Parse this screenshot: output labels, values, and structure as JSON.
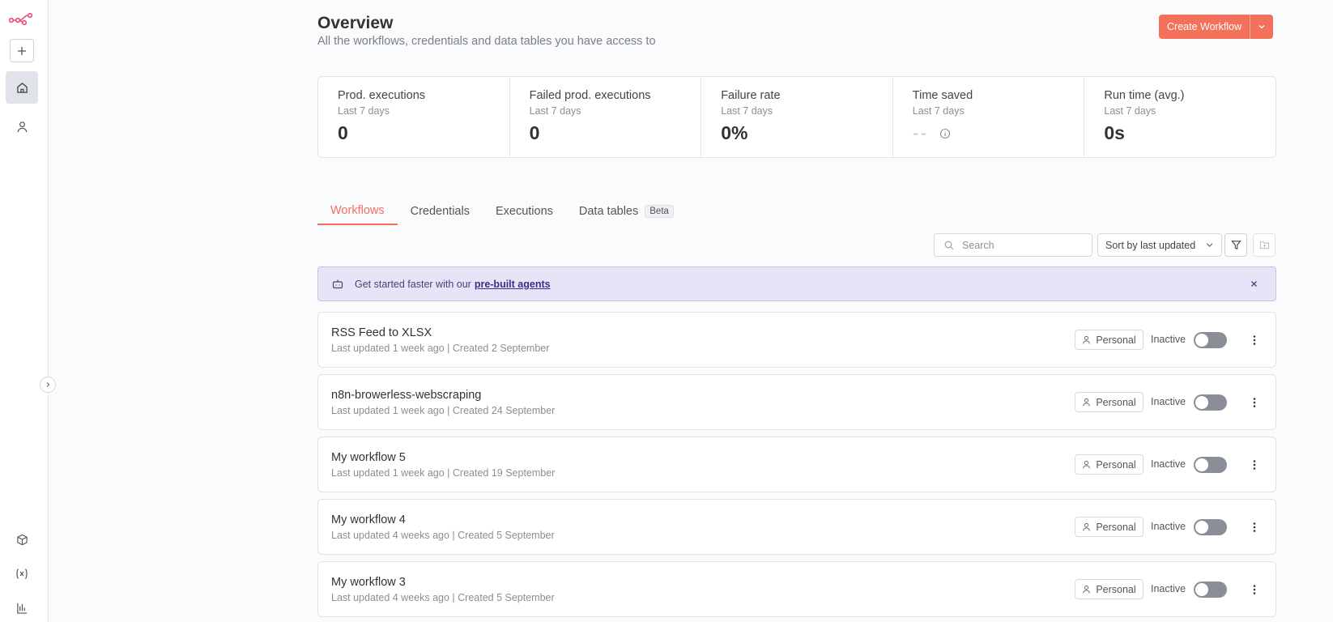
{
  "header": {
    "title": "Overview",
    "subtitle": "All the workflows, credentials and data tables you have access to",
    "create_label": "Create Workflow"
  },
  "stats": [
    {
      "label": "Prod. executions",
      "period": "Last 7 days",
      "value": "0"
    },
    {
      "label": "Failed prod. executions",
      "period": "Last 7 days",
      "value": "0"
    },
    {
      "label": "Failure rate",
      "period": "Last 7 days",
      "value": "0%"
    },
    {
      "label": "Time saved",
      "period": "Last 7 days",
      "value": "--"
    },
    {
      "label": "Run time (avg.)",
      "period": "Last 7 days",
      "value": "0s"
    }
  ],
  "tabs": [
    {
      "label": "Workflows",
      "active": true
    },
    {
      "label": "Credentials"
    },
    {
      "label": "Executions"
    },
    {
      "label": "Data tables",
      "badge": "Beta"
    }
  ],
  "toolbar": {
    "search_placeholder": "Search",
    "sort_label": "Sort by last updated"
  },
  "banner": {
    "text": "Get started faster with our",
    "link": "pre-built agents"
  },
  "workflows": [
    {
      "name": "RSS Feed to XLSX",
      "meta": "Last updated 1 week ago | Created 2 September",
      "owner": "Personal",
      "status": "Inactive"
    },
    {
      "name": "n8n-browerless-webscraping",
      "meta": "Last updated 1 week ago | Created 24 September",
      "owner": "Personal",
      "status": "Inactive"
    },
    {
      "name": "My workflow 5",
      "meta": "Last updated 1 week ago | Created 19 September",
      "owner": "Personal",
      "status": "Inactive"
    },
    {
      "name": "My workflow 4",
      "meta": "Last updated 4 weeks ago | Created 5 September",
      "owner": "Personal",
      "status": "Inactive"
    },
    {
      "name": "My workflow 3",
      "meta": "Last updated 4 weeks ago | Created 5 September",
      "owner": "Personal",
      "status": "Inactive"
    }
  ],
  "colors": {
    "accent": "#f3705a",
    "banner_bg": "#e8e4f7",
    "logo": "#ea4b71"
  }
}
